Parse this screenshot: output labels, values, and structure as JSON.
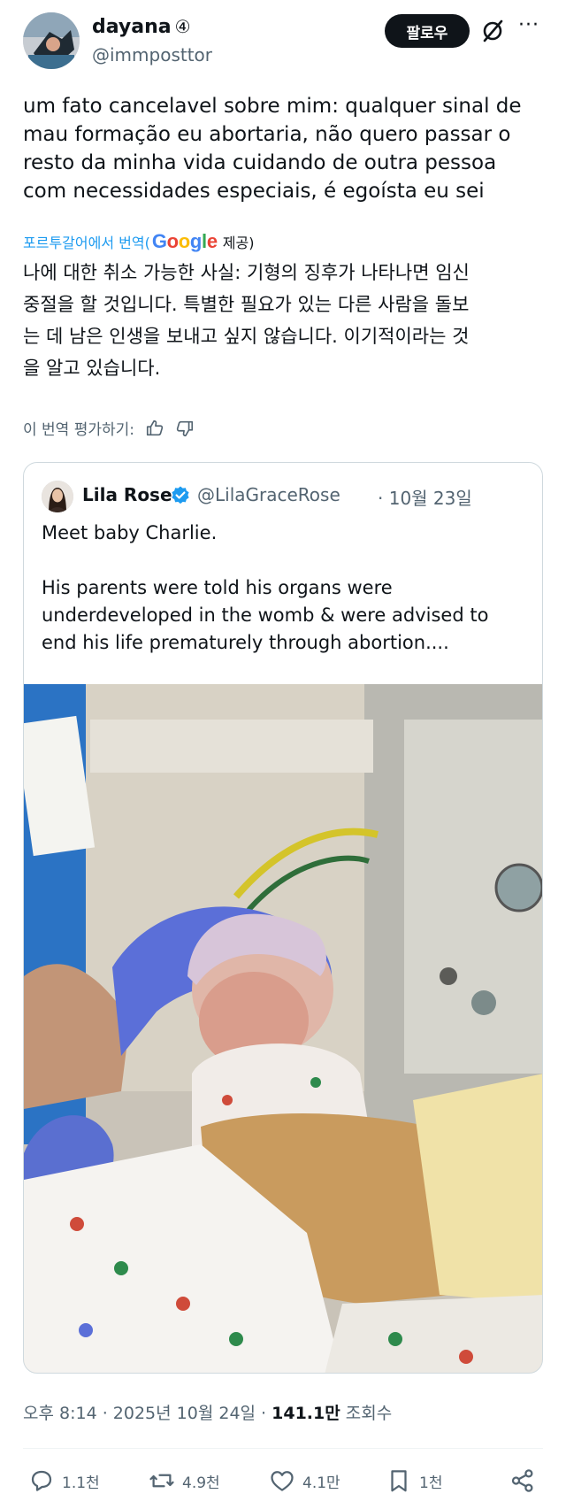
{
  "author": {
    "display_name": "dayana",
    "badge": "④",
    "handle": "@immposttor"
  },
  "follow_button": "팔로우",
  "more_label": "···",
  "tweet": {
    "text": "um fato cancelavel sobre mim: qualquer sinal de\nmau formação eu abortaria, não quero passar o\nresto da minha vida cuidando de outra pessoa\ncom necessidades especiais, é egoísta eu sei"
  },
  "translation": {
    "translated_from": "포르투갈어에서 번역(",
    "provider": "Google",
    "provided": "제공)",
    "text": "나에 대한 취소 가능한 사실: 기형의 징후가 나타나면 임신\n중절을 할 것입니다. 특별한 필요가 있는 다른 사람을 돌보\n는 데 남은 인생을 보내고 싶지 않습니다. 이기적이라는 것\n을 알고 있습니다.",
    "rate_label": "이 번역 평가하기:"
  },
  "quoted": {
    "name": "Lila Rose",
    "handle": "@LilaGraceRose",
    "date": "· 10월 23일",
    "text": "Meet baby Charlie.\n\nHis parents were told his organs were\nunderdeveloped in the womb & were advised to\nend his life prematurely through abortion...."
  },
  "meta": {
    "time": "오후 8:14 · 2025년 10월 24일 · ",
    "views_count": "141.1만",
    "views_label": " 조회수"
  },
  "actions": {
    "replies": "1.1천",
    "reposts": "4.9천",
    "likes": "4.1만",
    "bookmarks": "1천"
  },
  "colors": {
    "text": "#0f1419",
    "muted": "#536471",
    "link": "#1d9bf0",
    "border": "#cfd9de",
    "verified": "#1d9bf0"
  }
}
